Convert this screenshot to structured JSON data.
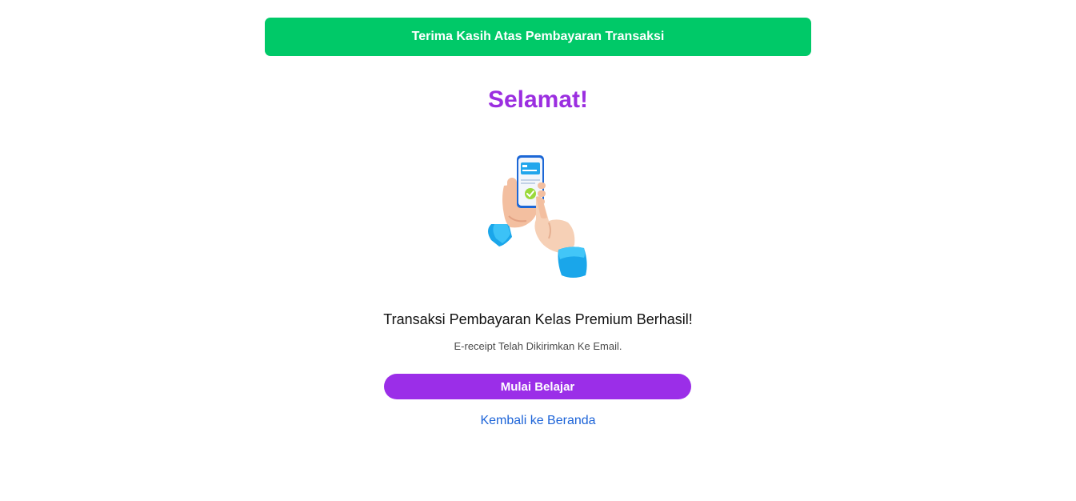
{
  "banner": {
    "text": "Terima Kasih Atas Pembayaran Transaksi",
    "color": "#00c968"
  },
  "main": {
    "title": "Selamat!",
    "illustration_icon": "hand-holding-phone-payment-success-icon",
    "success_heading": "Transaksi Pembayaran Kelas Premium Berhasil!",
    "receipt_text": "E-receipt Telah Dikirimkan Ke Email.",
    "start_button_label": "Mulai Belajar",
    "home_link_label": "Kembali ke Beranda"
  },
  "colors": {
    "accent_purple": "#9b2ee8",
    "link_blue": "#1d64d8",
    "success_green": "#00c968"
  }
}
